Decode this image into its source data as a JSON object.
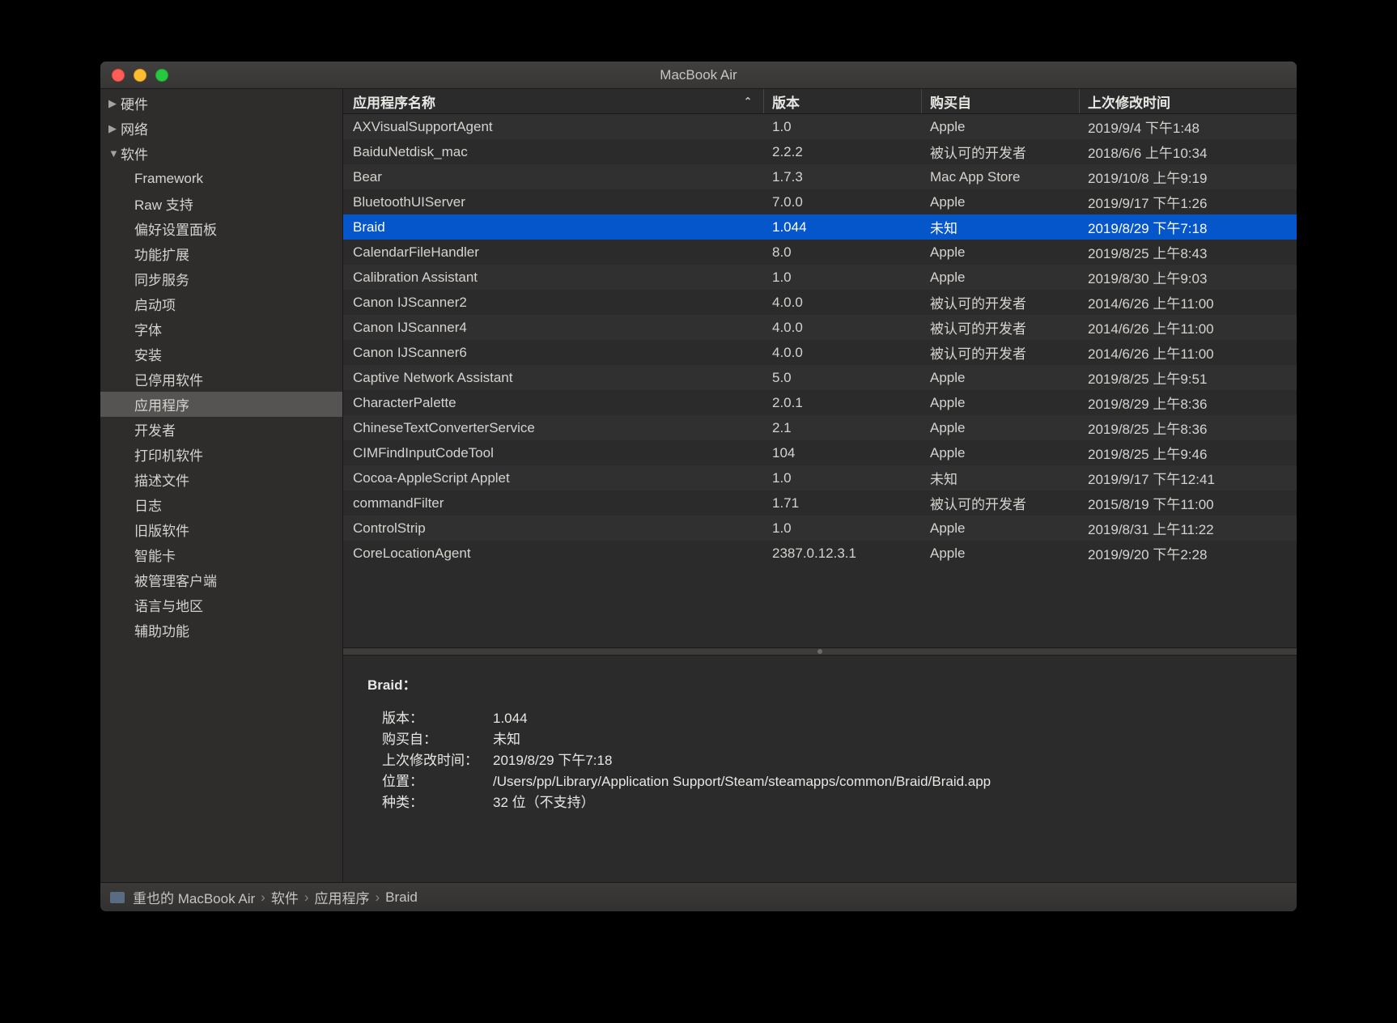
{
  "window": {
    "title": "MacBook Air"
  },
  "sidebar": {
    "top": [
      {
        "label": "硬件",
        "expanded": false
      },
      {
        "label": "网络",
        "expanded": false
      },
      {
        "label": "软件",
        "expanded": true
      }
    ],
    "children": [
      {
        "label": "Framework"
      },
      {
        "label": "Raw 支持"
      },
      {
        "label": "偏好设置面板"
      },
      {
        "label": "功能扩展"
      },
      {
        "label": "同步服务"
      },
      {
        "label": "启动项"
      },
      {
        "label": "字体"
      },
      {
        "label": "安装"
      },
      {
        "label": "已停用软件"
      },
      {
        "label": "应用程序",
        "active": true
      },
      {
        "label": "开发者"
      },
      {
        "label": "打印机软件"
      },
      {
        "label": "描述文件"
      },
      {
        "label": "日志"
      },
      {
        "label": "旧版软件"
      },
      {
        "label": "智能卡"
      },
      {
        "label": "被管理客户端"
      },
      {
        "label": "语言与地区"
      },
      {
        "label": "辅助功能"
      }
    ]
  },
  "table": {
    "headers": {
      "name": "应用程序名称",
      "version": "版本",
      "source": "购买自",
      "modified": "上次修改时间"
    },
    "rows": [
      {
        "name": "AXVisualSupportAgent",
        "version": "1.0",
        "source": "Apple",
        "modified": "2019/9/4 下午1:48"
      },
      {
        "name": "BaiduNetdisk_mac",
        "version": "2.2.2",
        "source": "被认可的开发者",
        "modified": "2018/6/6 上午10:34"
      },
      {
        "name": "Bear",
        "version": "1.7.3",
        "source": "Mac App Store",
        "modified": "2019/10/8 上午9:19"
      },
      {
        "name": "BluetoothUIServer",
        "version": "7.0.0",
        "source": "Apple",
        "modified": "2019/9/17 下午1:26"
      },
      {
        "name": "Braid",
        "version": "1.044",
        "source": "未知",
        "modified": "2019/8/29 下午7:18",
        "selected": true
      },
      {
        "name": "CalendarFileHandler",
        "version": "8.0",
        "source": "Apple",
        "modified": "2019/8/25 上午8:43"
      },
      {
        "name": "Calibration Assistant",
        "version": "1.0",
        "source": "Apple",
        "modified": "2019/8/30 上午9:03"
      },
      {
        "name": "Canon IJScanner2",
        "version": "4.0.0",
        "source": "被认可的开发者",
        "modified": "2014/6/26 上午11:00"
      },
      {
        "name": "Canon IJScanner4",
        "version": "4.0.0",
        "source": "被认可的开发者",
        "modified": "2014/6/26 上午11:00"
      },
      {
        "name": "Canon IJScanner6",
        "version": "4.0.0",
        "source": "被认可的开发者",
        "modified": "2014/6/26 上午11:00"
      },
      {
        "name": "Captive Network Assistant",
        "version": "5.0",
        "source": "Apple",
        "modified": "2019/8/25 上午9:51"
      },
      {
        "name": "CharacterPalette",
        "version": "2.0.1",
        "source": "Apple",
        "modified": "2019/8/29 上午8:36"
      },
      {
        "name": "ChineseTextConverterService",
        "version": "2.1",
        "source": "Apple",
        "modified": "2019/8/25 上午8:36"
      },
      {
        "name": "CIMFindInputCodeTool",
        "version": "104",
        "source": "Apple",
        "modified": "2019/8/25 上午9:46"
      },
      {
        "name": "Cocoa-AppleScript Applet",
        "version": "1.0",
        "source": "未知",
        "modified": "2019/9/17 下午12:41"
      },
      {
        "name": "commandFilter",
        "version": "1.71",
        "source": "被认可的开发者",
        "modified": "2015/8/19 下午11:00"
      },
      {
        "name": "ControlStrip",
        "version": "1.0",
        "source": "Apple",
        "modified": "2019/8/31 上午11:22"
      },
      {
        "name": "CoreLocationAgent",
        "version": "2387.0.12.3.1",
        "source": "Apple",
        "modified": "2019/9/20 下午2:28"
      }
    ]
  },
  "detail": {
    "title": "Braid：",
    "labels": {
      "version": "版本：",
      "source": "购买自：",
      "modified": "上次修改时间：",
      "location": "位置：",
      "kind": "种类："
    },
    "values": {
      "version": "1.044",
      "source": "未知",
      "modified": "2019/8/29 下午7:18",
      "location": "/Users/pp/Library/Application Support/Steam/steamapps/common/Braid/Braid.app",
      "kind": "32 位（不支持）"
    }
  },
  "footer": {
    "parts": [
      "重也的 MacBook Air",
      "软件",
      "应用程序",
      "Braid"
    ]
  }
}
